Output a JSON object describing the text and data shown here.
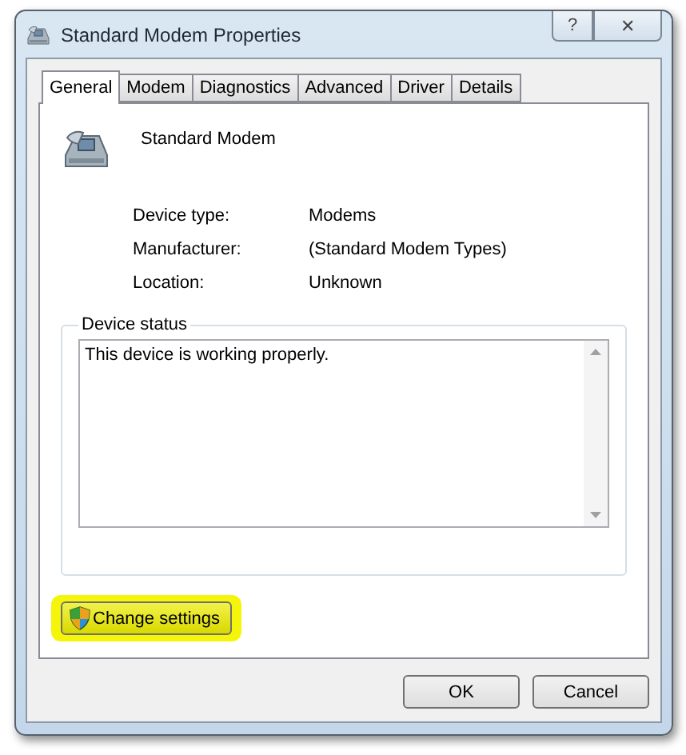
{
  "window": {
    "title": "Standard Modem Properties",
    "title_buttons": [
      "?",
      "✕"
    ]
  },
  "tabs": [
    {
      "label": "General",
      "selected": true
    },
    {
      "label": "Modem",
      "selected": false
    },
    {
      "label": "Diagnostics",
      "selected": false
    },
    {
      "label": "Advanced",
      "selected": false
    },
    {
      "label": "Driver",
      "selected": false
    },
    {
      "label": "Details",
      "selected": false
    }
  ],
  "device": {
    "name": "Standard Modem"
  },
  "properties": [
    {
      "label": "Device type:",
      "value": "Modems"
    },
    {
      "label": "Manufacturer:",
      "value": "(Standard Modem Types)"
    },
    {
      "label": "Location:",
      "value": "Unknown"
    }
  ],
  "device_status": {
    "title": "Device status",
    "text": "This device is working properly."
  },
  "change_settings": {
    "label": "Change settings",
    "highlighted": true
  },
  "buttons": [
    "OK",
    "Cancel"
  ]
}
